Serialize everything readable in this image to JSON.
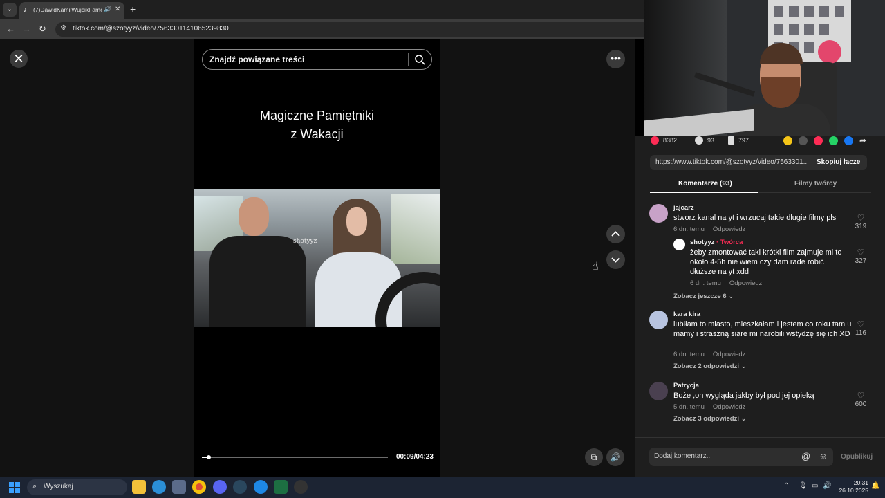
{
  "browser": {
    "tab_title": "(7)DawidKamilWujcikFamel",
    "url": "tiktok.com/@szotyyz/video/7563301141065239830"
  },
  "video": {
    "search_placeholder": "Znajdź powiązane treści",
    "title_line1": "Magiczne Pamiętniki",
    "title_line2": "z Wakacji",
    "watermark": "shotyyz",
    "time": "00:09/04:23",
    "progress_fraction": 0.036
  },
  "actions": {
    "likes": "8382",
    "comments": "93",
    "saves": "797"
  },
  "link": {
    "url": "https://www.tiktok.com/@szotyyz/video/7563301...",
    "copy_label": "Skopiuj łącze"
  },
  "panel_tabs": {
    "comments": "Komentarze (93)",
    "creator_videos": "Filmy twórcy"
  },
  "comments": [
    {
      "user": "jajcarz",
      "text": "stworz kanal na yt i wrzucaj takie dlugie filmy pls",
      "time": "6 dn. temu",
      "reply": "Odpowiedz",
      "likes": "319"
    },
    {
      "user": "shotyyz",
      "creator_label": "· Twórca",
      "text": "żeby zmontować taki krótki film zajmuje mi to około 4-5h nie wiem czy dam rade robić dłuższe na yt xdd",
      "time": "6 dn. temu",
      "reply": "Odpowiedz",
      "likes": "327"
    },
    {
      "more": "Zobacz jeszcze 6"
    },
    {
      "user": "kara kira",
      "text": "lubiłam to miasto, mieszkałam i jestem co roku tam u mamy i straszną siare mi narobili wstydzę się ich XD",
      "time": "6 dn. temu",
      "reply": "Odpowiedz",
      "likes": "116",
      "more": "Zobacz 2 odpowiedzi"
    },
    {
      "user": "Patrycja",
      "text": "Boże ,on wygląda jakby był pod jej opieką",
      "time": "5 dn. temu",
      "reply": "Odpowiedz",
      "likes": "600",
      "more": "Zobacz 3 odpowiedzi"
    }
  ],
  "composer": {
    "placeholder": "Dodaj komentarz...",
    "post_label": "Opublikuj"
  },
  "taskbar": {
    "search": "Wyszukaj",
    "time": "20:31",
    "date": "26.10.2025"
  },
  "colors": {
    "accent": "#fe2c55",
    "page_bg": "#121212",
    "panel_bg": "#1e1e1e",
    "taskbar_bg": "#1c2433"
  }
}
